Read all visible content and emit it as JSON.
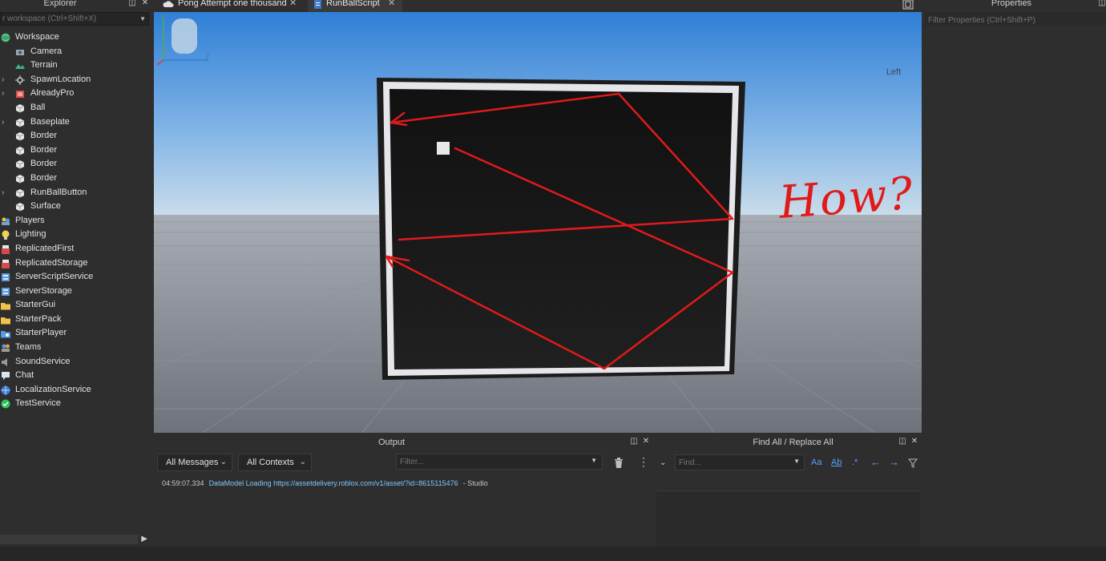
{
  "explorer": {
    "title": "Explorer",
    "filter_placeholder": "r workspace (Ctrl+Shift+X)",
    "items": [
      {
        "label": "Workspace",
        "level": 0,
        "icon": "globe-icon",
        "expandable": false
      },
      {
        "label": "Camera",
        "level": 1,
        "icon": "camera-icon",
        "expandable": false
      },
      {
        "label": "Terrain",
        "level": 1,
        "icon": "terrain-icon",
        "expandable": false
      },
      {
        "label": "SpawnLocation",
        "level": 1,
        "icon": "spawn-icon",
        "expandable": true
      },
      {
        "label": "AlreadyPro",
        "level": 1,
        "icon": "model-icon",
        "expandable": true
      },
      {
        "label": "Ball",
        "level": 1,
        "icon": "part-icon",
        "expandable": false
      },
      {
        "label": "Baseplate",
        "level": 1,
        "icon": "part-icon",
        "expandable": true
      },
      {
        "label": "Border",
        "level": 1,
        "icon": "part-icon",
        "expandable": false
      },
      {
        "label": "Border",
        "level": 1,
        "icon": "part-icon",
        "expandable": false
      },
      {
        "label": "Border",
        "level": 1,
        "icon": "part-icon",
        "expandable": false
      },
      {
        "label": "Border",
        "level": 1,
        "icon": "part-icon",
        "expandable": false
      },
      {
        "label": "RunBallButton",
        "level": 1,
        "icon": "part-icon",
        "expandable": true
      },
      {
        "label": "Surface",
        "level": 1,
        "icon": "part-icon",
        "expandable": false
      },
      {
        "label": "Players",
        "level": 0,
        "icon": "players-icon",
        "expandable": false
      },
      {
        "label": "Lighting",
        "level": 0,
        "icon": "lightbulb-icon",
        "expandable": false
      },
      {
        "label": "ReplicatedFirst",
        "level": 0,
        "icon": "replicated-icon",
        "expandable": false
      },
      {
        "label": "ReplicatedStorage",
        "level": 0,
        "icon": "replicated-icon",
        "expandable": false
      },
      {
        "label": "ServerScriptService",
        "level": 0,
        "icon": "server-icon",
        "expandable": false
      },
      {
        "label": "ServerStorage",
        "level": 0,
        "icon": "server-icon",
        "expandable": false
      },
      {
        "label": "StarterGui",
        "level": 0,
        "icon": "folder-icon",
        "expandable": false
      },
      {
        "label": "StarterPack",
        "level": 0,
        "icon": "folder-icon",
        "expandable": false
      },
      {
        "label": "StarterPlayer",
        "level": 0,
        "icon": "starterplayer-icon",
        "expandable": false
      },
      {
        "label": "Teams",
        "level": 0,
        "icon": "teams-icon",
        "expandable": false
      },
      {
        "label": "SoundService",
        "level": 0,
        "icon": "speaker-icon",
        "expandable": false
      },
      {
        "label": "Chat",
        "level": 0,
        "icon": "chat-icon",
        "expandable": false
      },
      {
        "label": "LocalizationService",
        "level": 0,
        "icon": "localization-icon",
        "expandable": false
      },
      {
        "label": "TestService",
        "level": 0,
        "icon": "check-icon",
        "expandable": false
      }
    ]
  },
  "tabs": [
    {
      "label": "Pong Attempt one thousand",
      "icon": "cloud-icon",
      "active": false
    },
    {
      "label": "RunBallScript",
      "icon": "script-icon",
      "active": true
    }
  ],
  "viewport": {
    "view_cube_label": "Left",
    "annotation_text": "How?",
    "annotation_color": "#e01a1a"
  },
  "properties": {
    "title": "Properties",
    "filter_placeholder": "Filter Properties (Ctrl+Shift+P)"
  },
  "output": {
    "title": "Output",
    "messages_filter": "All Messages",
    "contexts_filter": "All Contexts",
    "filter_placeholder": "Filter...",
    "log": {
      "timestamp": "04:59:07.334",
      "message": "DataModel Loading https://assetdelivery.roblox.com/v1/asset/?id=8615115476",
      "source": "-  Studio"
    }
  },
  "find": {
    "title": "Find All / Replace All",
    "placeholder": "Find...",
    "match_case": "Aa",
    "whole_word": "Ab",
    "regex": ".*"
  },
  "colors": {
    "accent": "#5aa0ff",
    "panel_bg": "#2e2e2e",
    "link": "#7ec8ff"
  }
}
